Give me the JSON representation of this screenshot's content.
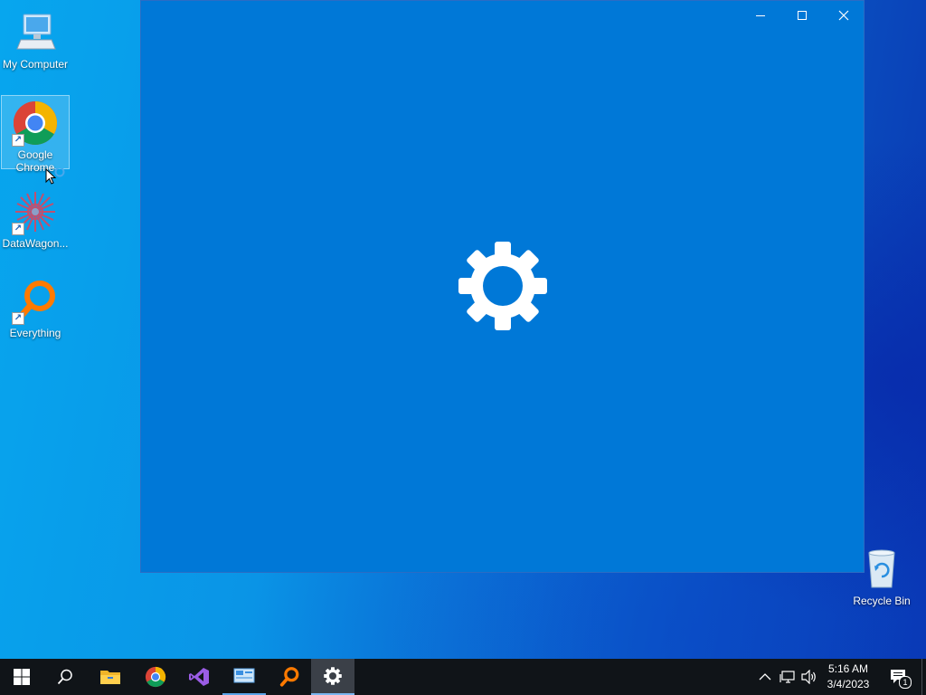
{
  "desktop": {
    "icons": [
      {
        "label": "My Computer",
        "icon": "computer-icon"
      },
      {
        "label": "Google Chrome",
        "icon": "chrome-icon"
      },
      {
        "label": "DataWagon...",
        "icon": "datawagon-icon"
      },
      {
        "label": "Everything",
        "icon": "everything-icon"
      },
      {
        "label": "Recycle Bin",
        "icon": "recycle-bin-icon"
      }
    ]
  },
  "window": {
    "app": "Settings",
    "splash_icon": "gear-icon",
    "background": "#0078d7",
    "controls": [
      "minimize",
      "maximize",
      "close"
    ]
  },
  "taskbar": {
    "items": [
      "start",
      "search",
      "file-explorer",
      "chrome",
      "visual-studio",
      "control-panel",
      "everything",
      "settings"
    ],
    "active": "settings",
    "tray": [
      "chevron-up-icon",
      "network-icon",
      "volume-icon"
    ],
    "clock": {
      "time": "5:16 AM",
      "date": "3/4/2023"
    },
    "notifications": {
      "count": "1"
    }
  }
}
